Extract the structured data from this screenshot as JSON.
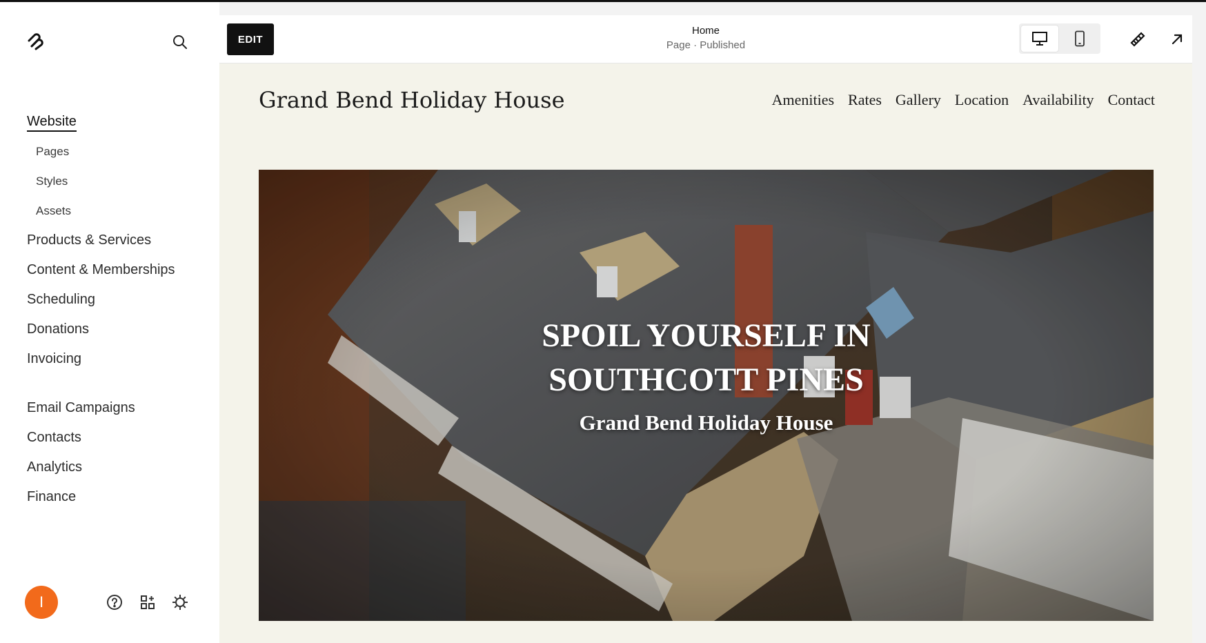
{
  "sidebar": {
    "logo_icon": "squarespace-logo-icon",
    "search_icon": "search-icon",
    "active_item": "Website",
    "sub_items": [
      "Pages",
      "Styles",
      "Assets"
    ],
    "items_group1": [
      "Products & Services",
      "Content & Memberships",
      "Scheduling",
      "Donations",
      "Invoicing"
    ],
    "items_group2": [
      "Email Campaigns",
      "Contacts",
      "Analytics",
      "Finance"
    ],
    "avatar_initial": "I",
    "avatar_color": "#f26a1b",
    "footer_icons": [
      "help-icon",
      "apps-icon",
      "settings-icon"
    ]
  },
  "toolbar": {
    "edit_label": "EDIT",
    "page_title": "Home",
    "page_status": "Page · Published",
    "devices": [
      "desktop-icon",
      "mobile-icon"
    ],
    "tools": [
      "style-brush-icon",
      "open-external-icon"
    ]
  },
  "site": {
    "title": "Grand Bend Holiday House",
    "nav": [
      "Amenities",
      "Rates",
      "Gallery",
      "Location",
      "Availability",
      "Contact"
    ],
    "hero_line1": "SPOIL YOURSELF IN",
    "hero_line2": "SOUTHCOTT PINES",
    "hero_sub": "Grand Bend Holiday House",
    "background": "#f4f3ea"
  }
}
